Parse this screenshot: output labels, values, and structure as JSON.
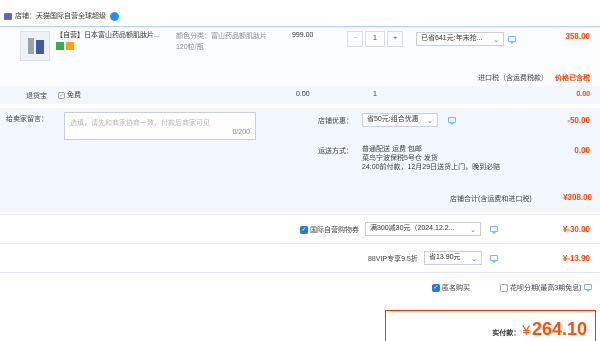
{
  "shop": {
    "label": "店铺：天猫国际自营全球超级"
  },
  "item": {
    "tag": "【自营】",
    "title": "日本富山药品额肌肽片...",
    "spec": "颜色分类：富山药品额肌肽片120粒/瓶",
    "unit_price": "999.00",
    "quantity": "1",
    "minus": "−",
    "plus": "+",
    "promo_select": "已省641元:年末抢...",
    "subtotal": "358.00",
    "import_tax_label": "进口税（含运费税款）",
    "import_tax_value": "价格已含税"
  },
  "service": {
    "label": "退货宝",
    "option": "免费",
    "price": "0.00",
    "qty": "1",
    "total": "0.00"
  },
  "message": {
    "label": "给卖家留言：",
    "placeholder": "选填，请先和商家协商一致，付款后商家可见",
    "counter": "0/200"
  },
  "shop_discount": {
    "label": "店铺优惠：",
    "select": "省50元:组合优惠",
    "value": "-50.00"
  },
  "shipping": {
    "label": "运送方式：",
    "line1": "普通配送 运费 包邮",
    "line2": "菜鸟宁波保税5号仓 发货",
    "line3": "24:00前付款，12月29日送货上门，晚到必赔",
    "value": "0.00"
  },
  "shop_total": {
    "label": "店铺合计(含运费和进口税)",
    "value": "¥308.00"
  },
  "coupon": {
    "label": "国际自营购物券",
    "select": "满300减30元（2024.12.2...",
    "value": "¥-30.00"
  },
  "vip": {
    "label": "88VIP专享9.5折",
    "select": "省13.90元",
    "value": "¥-13.90"
  },
  "options": {
    "anonymous": "匿名购买",
    "installment": "花呗分期(最高3期免息)"
  },
  "pay": {
    "label": "实付款：",
    "currency": "¥",
    "amount": "264.10"
  },
  "colors": {
    "accent": "#ff5000",
    "blue": "#2a7ad9",
    "section_bg": "#f2f7ff"
  }
}
